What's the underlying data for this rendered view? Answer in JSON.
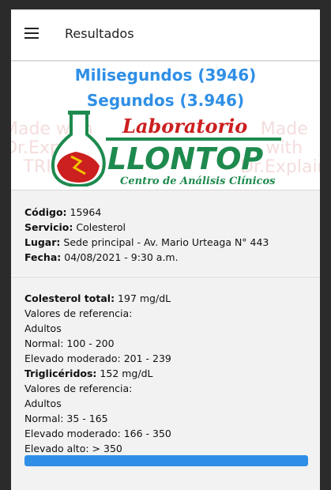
{
  "appbar": {
    "title": "Resultados"
  },
  "timing": {
    "ms_line": "Milisegundos (3946)",
    "s_line": "Segundos (3.946)"
  },
  "logo": {
    "brand_top": "Laboratorio",
    "brand_main": "LLONTOP",
    "brand_sub": "Centro de Análisis Clínicos"
  },
  "watermark": {
    "line1": "Made with",
    "line2": "Dr.Explain",
    "line3": "TRIAL"
  },
  "info": {
    "codigo_label": "Código:",
    "codigo_value": "15964",
    "servicio_label": "Servicio:",
    "servicio_value": "Colesterol",
    "lugar_label": "Lugar:",
    "lugar_value": "Sede principal - Av. Mario Urteaga N° 443",
    "fecha_label": "Fecha:",
    "fecha_value": "04/08/2021 - 9:30 a.m."
  },
  "results": {
    "colesterol_label": "Colesterol total:",
    "colesterol_value": "197 mg/dL",
    "ref1": "Valores de referencia:",
    "adultos1": "Adultos",
    "normal1": "Normal: 100 - 200",
    "moderado1": "Elevado moderado: 201 - 239",
    "trigliceridos_label": "Triglicéridos:",
    "trigliceridos_value": "152 mg/dL",
    "ref2": "Valores de referencia:",
    "adultos2": "Adultos",
    "normal2": "Normal: 35 - 165",
    "moderado2": "Elevado moderado: 166 - 350",
    "alto2": "Elevado alto: > 350"
  },
  "progress": {
    "fraction": 1.0
  },
  "colors": {
    "accent": "#2f8fe6",
    "brand_red": "#cc1f1f",
    "brand_green": "#1e8a4e"
  }
}
